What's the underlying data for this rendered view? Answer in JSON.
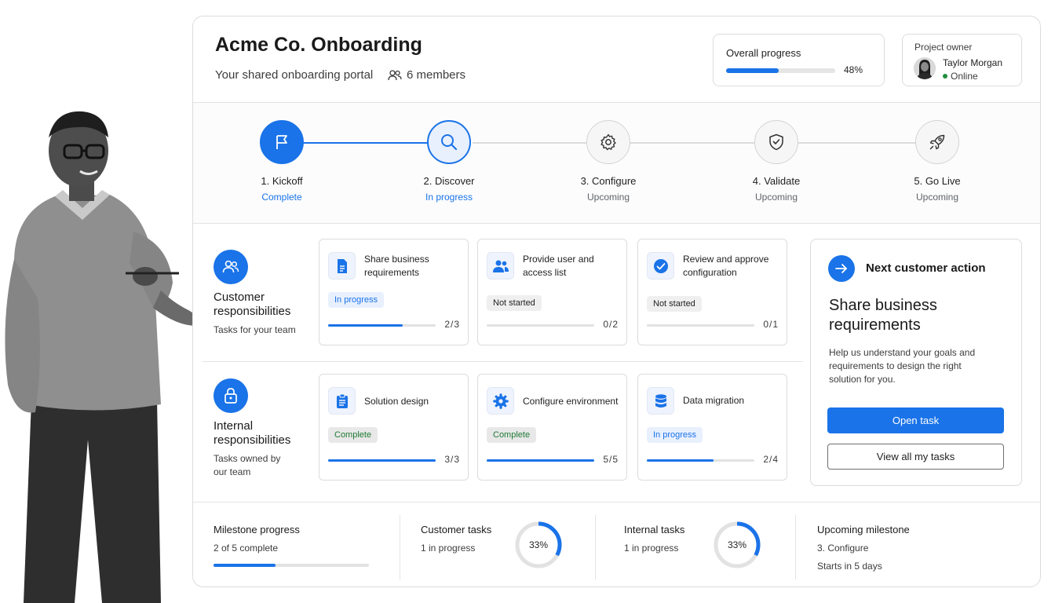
{
  "header": {
    "title": "Acme Co. Onboarding",
    "subtitle": "Your shared onboarding portal",
    "members": "6 members",
    "overall_progress_label": "Overall progress",
    "overall_progress_pct": "48%",
    "overall_progress_value": 0.48,
    "owner_label": "Project owner",
    "owner_name": "Taylor Morgan",
    "owner_status": "Online"
  },
  "steps": [
    {
      "name": "1. Kickoff",
      "status": "Complete",
      "state": "done",
      "icon": "flag-icon"
    },
    {
      "name": "2. Discover",
      "status": "In progress",
      "state": "active",
      "icon": "search-icon"
    },
    {
      "name": "3. Configure",
      "status": "Upcoming",
      "state": "upcoming",
      "icon": "gear-icon"
    },
    {
      "name": "4. Validate",
      "status": "Upcoming",
      "state": "upcoming",
      "icon": "shield-check-icon"
    },
    {
      "name": "5. Go Live",
      "status": "Upcoming",
      "state": "upcoming",
      "icon": "rocket-icon"
    }
  ],
  "customer": {
    "title": "Customer responsibilities",
    "subtitle": "Tasks for your team",
    "tasks": [
      {
        "name": "Share business requirements",
        "status": "In progress",
        "count": "2/3",
        "progress": 0.67,
        "icon": "document-icon"
      },
      {
        "name": "Provide user and access list",
        "status": "Not started",
        "count": "0/2",
        "progress": 0,
        "icon": "users-icon"
      },
      {
        "name": "Review and approve configuration",
        "status": "Not started",
        "count": "0/1",
        "progress": 0,
        "icon": "check-circle-icon"
      }
    ]
  },
  "internal": {
    "title": "Internal responsibilities",
    "subtitle": "Tasks owned by our team",
    "tasks": [
      {
        "name": "Solution design",
        "status": "Complete",
        "count": "3/3",
        "progress": 1,
        "icon": "clipboard-icon"
      },
      {
        "name": "Configure environment",
        "status": "Complete",
        "count": "5/5",
        "progress": 1,
        "icon": "gear-icon"
      },
      {
        "name": "Data migration",
        "status": "In progress",
        "count": "2/4",
        "progress": 0.5,
        "icon": "database-icon"
      }
    ]
  },
  "next_action": {
    "heading": "Next customer action",
    "title": "Share business requirements",
    "description": "Help us understand your goals and requirements to design the right solution for you.",
    "primary_button": "Open task",
    "secondary_button": "View all my tasks"
  },
  "footer": {
    "milestone_title": "Milestone progress",
    "milestone_sub": "2 of 5 complete",
    "milestone_value": 0.4,
    "customer_title": "Customer tasks",
    "customer_sub": "1 in progress",
    "customer_pct": "33%",
    "customer_value": 0.33,
    "internal_title": "Internal tasks",
    "internal_sub": "1 in progress",
    "internal_pct": "33%",
    "internal_value": 0.33,
    "upcoming_title": "Upcoming milestone",
    "upcoming_sub": "3. Configure",
    "upcoming_sub2": "Starts in 5 days"
  },
  "colors": {
    "accent": "#1a73e8",
    "success": "#1e8e3e"
  }
}
